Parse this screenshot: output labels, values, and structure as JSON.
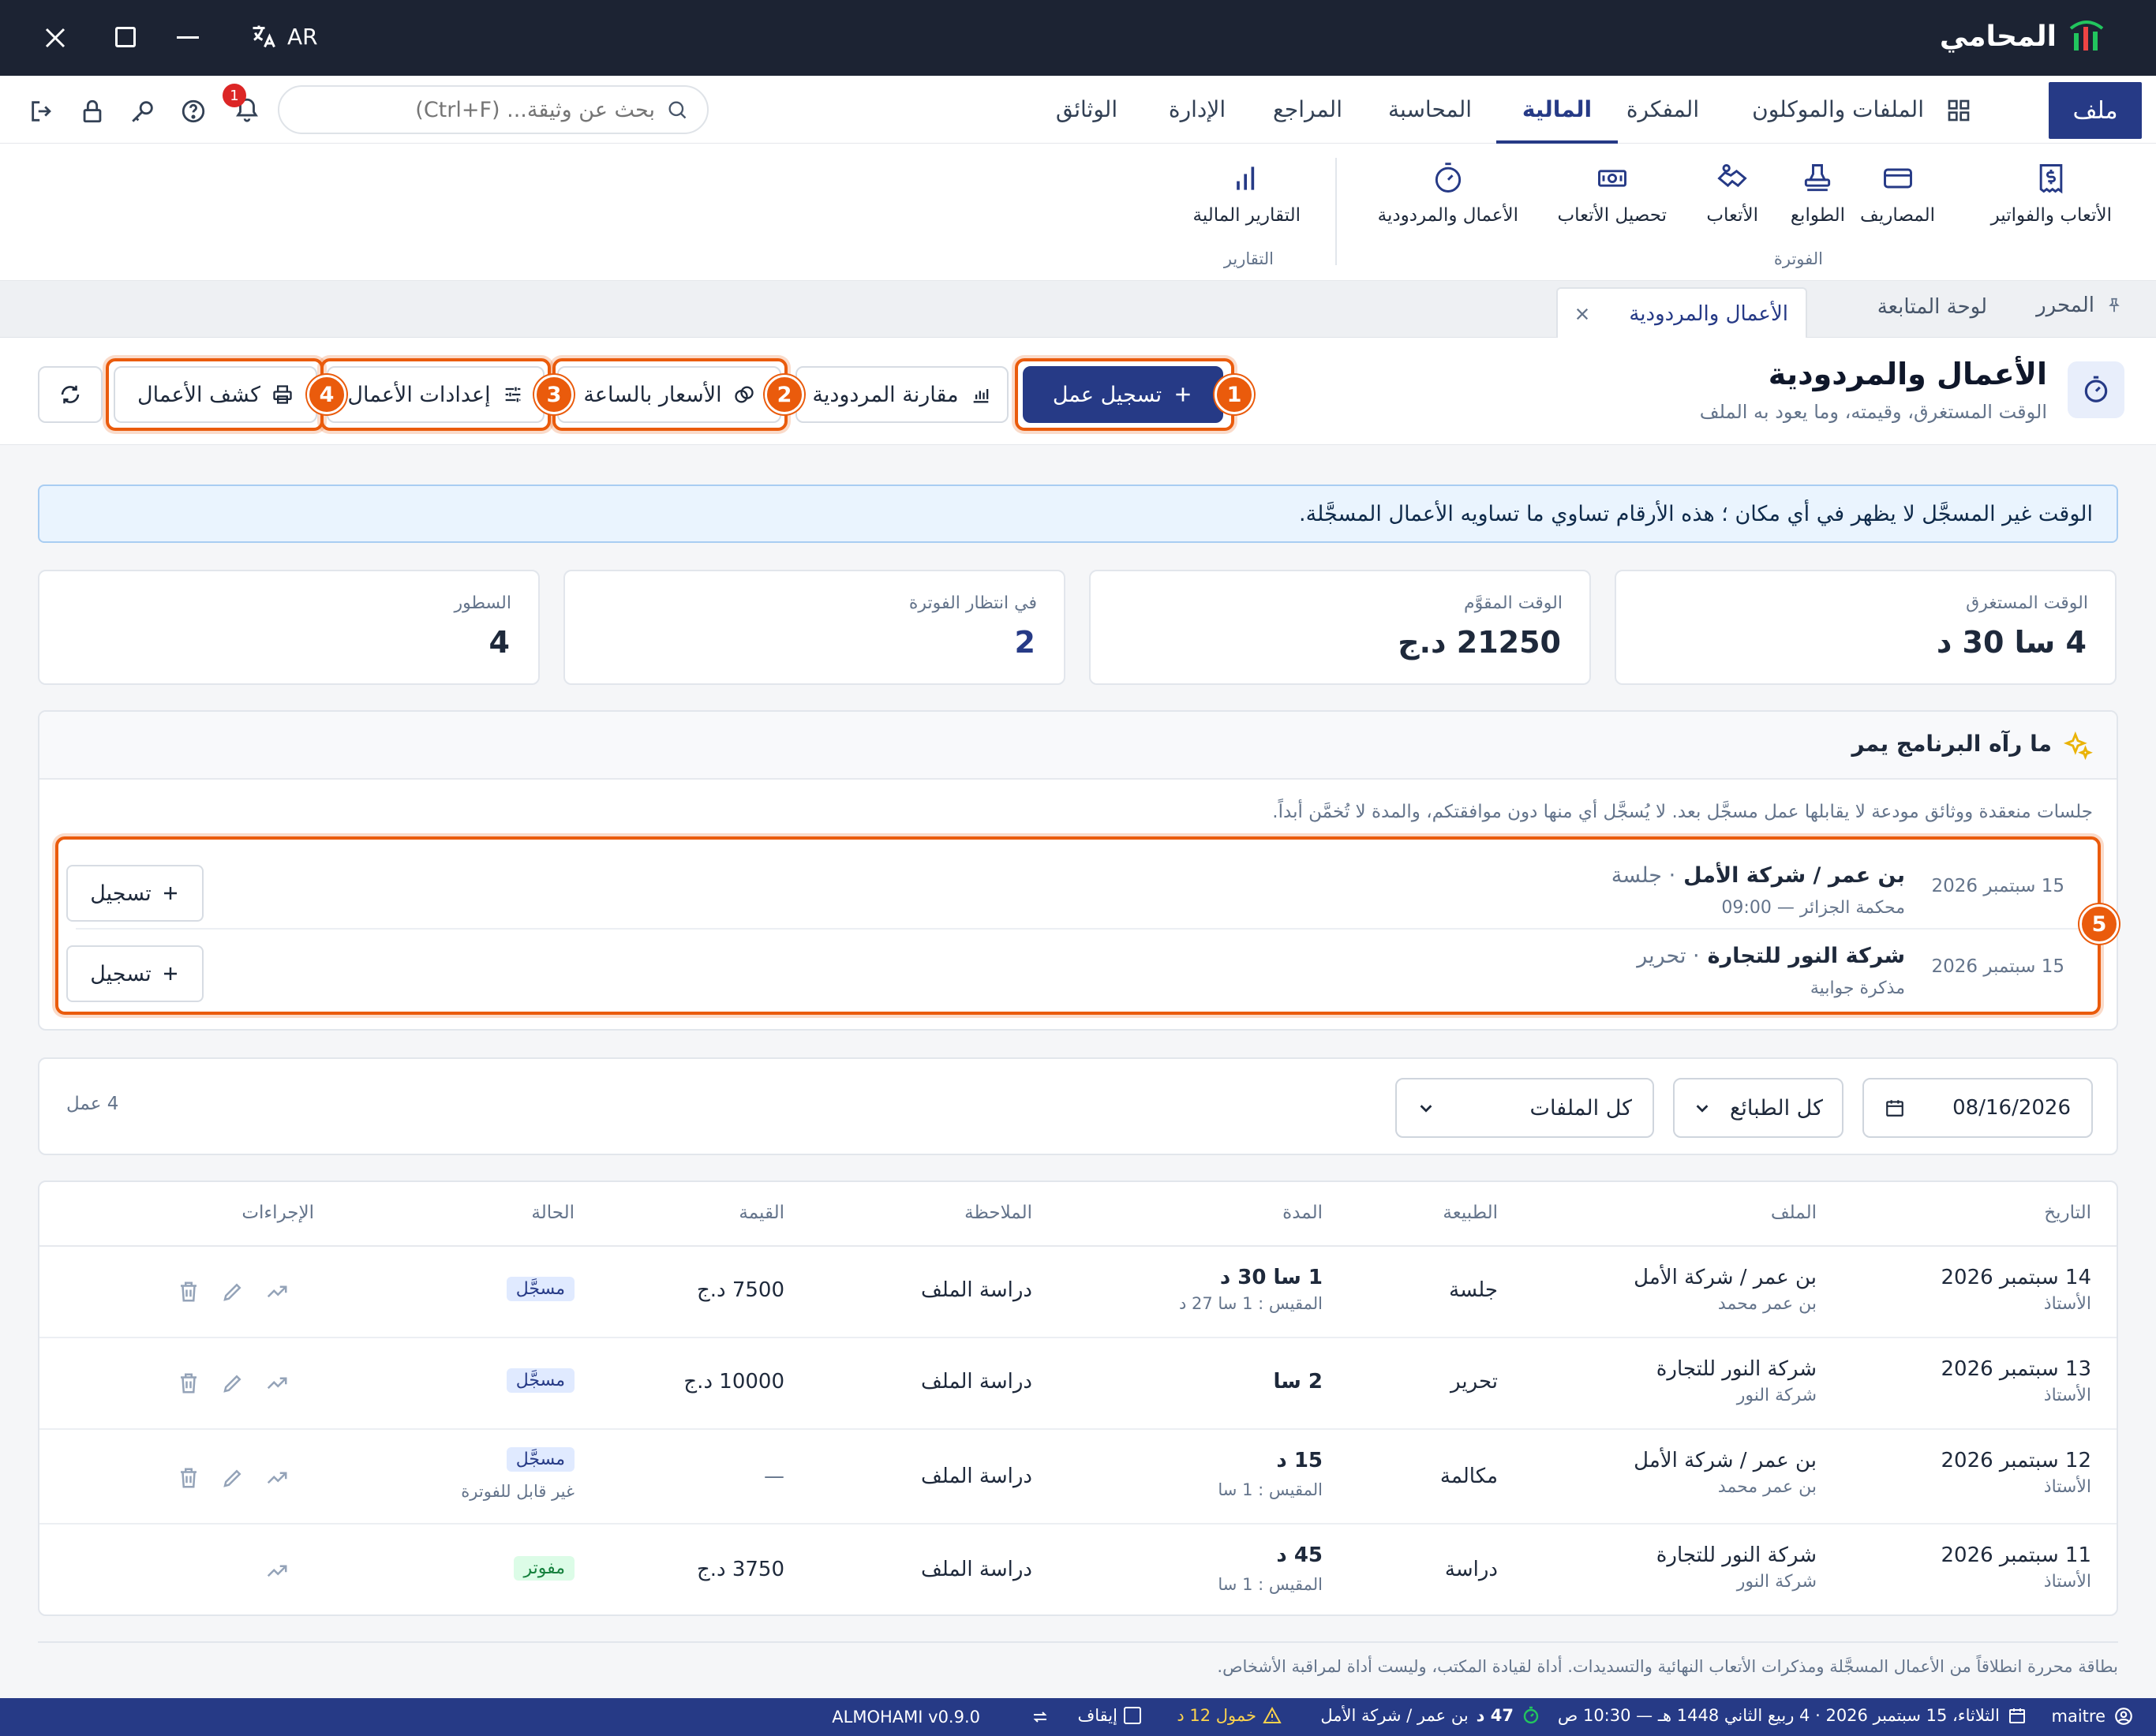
{
  "app": {
    "name": "المحامي",
    "lang": "AR"
  },
  "menu": {
    "file": "ملف",
    "items": [
      "الملفات والموكلون",
      "المفكرة",
      "المالية",
      "المحاسبة",
      "المراجع",
      "الإدارة",
      "الوثائق"
    ],
    "search_placeholder": "بحث عن وثيقة... (Ctrl+F)",
    "notif_count": "1"
  },
  "ribbon": {
    "groups": [
      {
        "label": "الفوترة"
      },
      {
        "label": "التقارير"
      }
    ],
    "items": [
      "الأتعاب والفواتير",
      "المصاريف",
      "الطوابع",
      "الأتعاب",
      "تحصيل الأتعاب",
      "الأعمال والمردودية",
      "التقارير المالية"
    ]
  },
  "tabs": {
    "editor": "المحرر",
    "dashboard": "لوحة المتابعة",
    "active": "الأعمال والمردودية"
  },
  "page": {
    "title": "الأعمال والمردودية",
    "subtitle": "الوقت المستغرق، وقيمته، وما يعود به الملف"
  },
  "toolbar": {
    "log_work": "تسجيل عمل",
    "compare": "مقارنة المردودية",
    "hourly_rates": "الأسعار بالساعة",
    "settings": "إعدادات الأعمال",
    "statement": "كشف الأعمال"
  },
  "markers": [
    "1",
    "2",
    "3",
    "4",
    "5"
  ],
  "banner": "الوقت غير المسجَّل لا يظهر في أي مكان ؛ هذه الأرقام تساوي ما تساويه الأعمال المسجَّلة.",
  "stats": [
    {
      "label": "الوقت المستغرق",
      "value": "4 سا 30 د"
    },
    {
      "label": "الوقت المقوَّم",
      "value": "21250 د.ج"
    },
    {
      "label": "في انتظار الفوترة",
      "value": "2"
    },
    {
      "label": "السطور",
      "value": "4"
    }
  ],
  "suggestions": {
    "title": "ما رآه البرنامج يمر",
    "description": "جلسات منعقدة ووثائق مودعة لا يقابلها عمل مسجَّل بعد. لا يُسجَّل أي منها دون موافقتكم، والمدة لا تُخمَّن أبداً.",
    "register_label": "تسجيل",
    "items": [
      {
        "date": "15 سبتمبر 2026",
        "title": "بن عمر / شركة الأمل",
        "kind": "· جلسة",
        "sub": "محكمة الجزائر — 09:00"
      },
      {
        "date": "15 سبتمبر 2026",
        "title": "شركة النور للتجارة",
        "kind": "· تحرير",
        "sub": "مذكرة جوابية"
      }
    ]
  },
  "filters": {
    "date": "08/16/2026",
    "nature": "كل الطبائع",
    "files": "كل الملفات",
    "count": "4 عمل"
  },
  "table": {
    "headers": [
      "التاريخ",
      "الملف",
      "الطبيعة",
      "المدة",
      "الملاحظة",
      "القيمة",
      "الحالة",
      "الإجراءات"
    ],
    "rows": [
      {
        "date": "14 سبتمبر 2026",
        "author": "الأستاذ",
        "file": "بن عمر / شركة الأمل",
        "client": "بن عمر محمد",
        "nature": "جلسة",
        "duration": "1 سا 30 د",
        "measured": "المقيس : 1 سا 27 د",
        "note": "دراسة الملف",
        "value": "7500 د.ج",
        "status": "مسجَّل",
        "status_sub": ""
      },
      {
        "date": "13 سبتمبر 2026",
        "author": "الأستاذ",
        "file": "شركة النور للتجارة",
        "client": "شركة النور",
        "nature": "تحرير",
        "duration": "2 سا",
        "measured": "",
        "note": "دراسة الملف",
        "value": "10000 د.ج",
        "status": "مسجَّل",
        "status_sub": ""
      },
      {
        "date": "12 سبتمبر 2026",
        "author": "الأستاذ",
        "file": "بن عمر / شركة الأمل",
        "client": "بن عمر محمد",
        "nature": "مكالمة",
        "duration": "15 د",
        "measured": "المقيس : 1 سا",
        "note": "دراسة الملف",
        "value": "—",
        "status": "مسجَّل",
        "status_sub": "غير قابل للفوترة"
      },
      {
        "date": "11 سبتمبر 2026",
        "author": "الأستاذ",
        "file": "شركة النور للتجارة",
        "client": "شركة النور",
        "nature": "دراسة",
        "duration": "45 د",
        "measured": "المقيس : 1 سا",
        "note": "دراسة الملف",
        "value": "3750 د.ج",
        "status": "مفوتر",
        "status_sub": ""
      }
    ]
  },
  "footnote": "بطاقة محررة انطلاقاً من الأعمال المسجَّلة ومذكرات الأتعاب النهائية والتسديدات. أداة لقيادة المكتب، وليست أداة لمراقبة الأشخاص.",
  "statusbar": {
    "user": "maitre",
    "date": "الثلاثاء، 15 سبتمبر 2026 · 4 ربيع الثاني 1448 هـ — 10:30 ص",
    "timer": "47 د",
    "timer_file": "بن عمر / شركة الأمل",
    "idle": "خمول 12 د",
    "stop": "إيقاف",
    "version": "ALMOHAMI v0.9.0"
  },
  "colors": {
    "primary": "#263a86",
    "accent": "#ea5b0c",
    "titlebar": "#1c2333",
    "status_green": "#dcfce7",
    "status_blue": "#e0eaff"
  }
}
